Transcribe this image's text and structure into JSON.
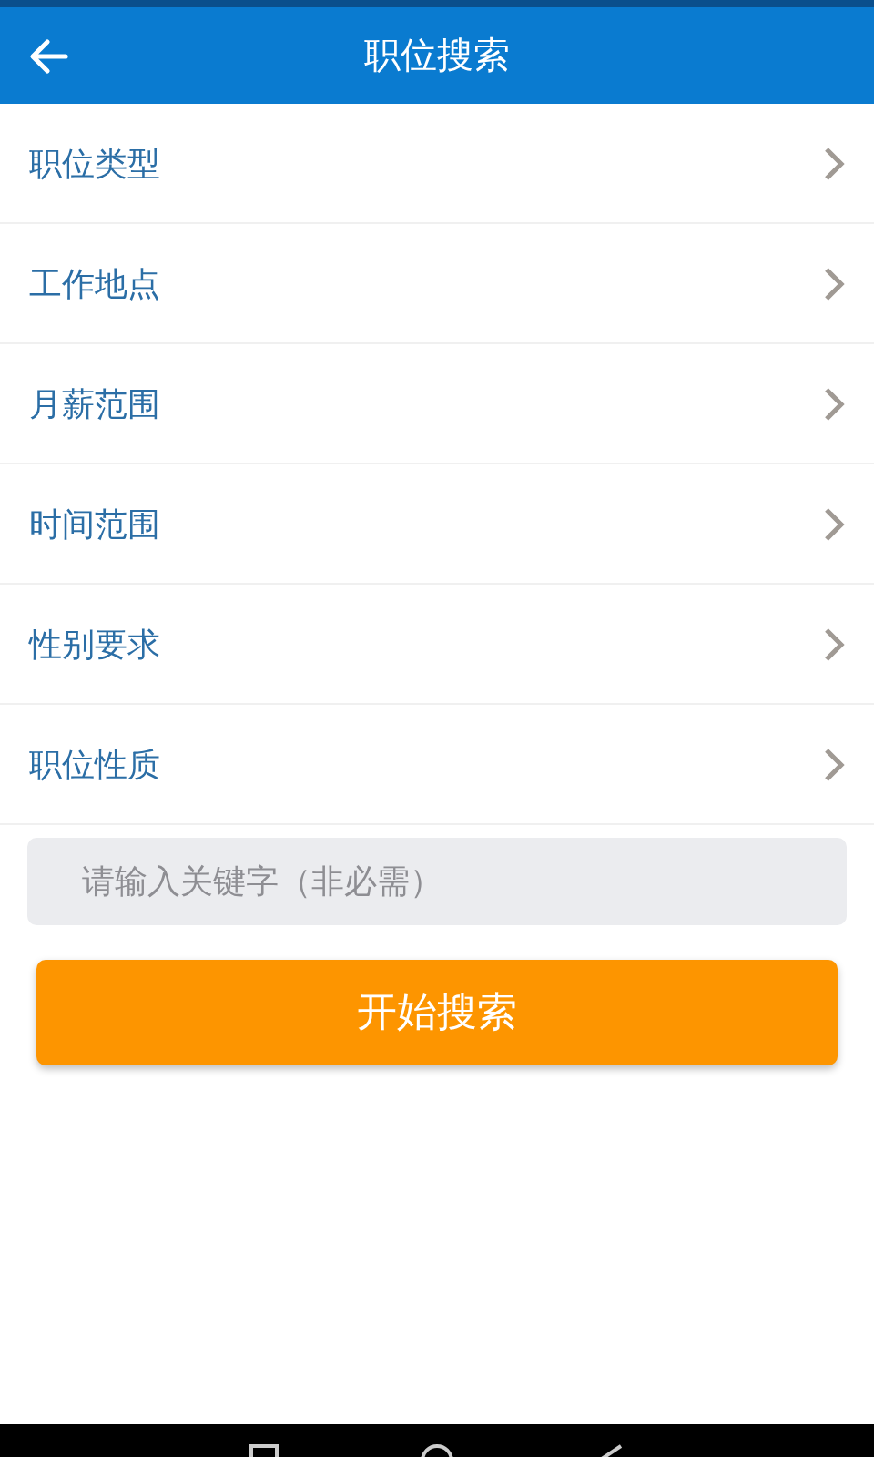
{
  "header": {
    "title": "职位搜索"
  },
  "filters": [
    {
      "label": "职位类型"
    },
    {
      "label": "工作地点"
    },
    {
      "label": "月薪范围"
    },
    {
      "label": "时间范围"
    },
    {
      "label": "性别要求"
    },
    {
      "label": "职位性质"
    }
  ],
  "keyword": {
    "placeholder": "请输入关键字（非必需）"
  },
  "search_button": {
    "label": "开始搜索"
  }
}
